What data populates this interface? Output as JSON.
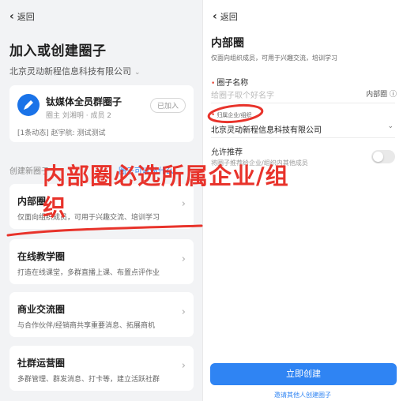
{
  "left": {
    "back": "返回",
    "title": "加入或创建圈子",
    "org": "北京灵动新程信息科技有限公司",
    "joined_circle": {
      "name": "钛媒体全员群圈子",
      "meta": "圈主 刘湘明 · 成员 2",
      "status": "已加入",
      "activity": "[1条动态] 赵宇航: 测试测试"
    },
    "section_label": "创建新圈子",
    "section_hint": "圈子可以做什么",
    "types": [
      {
        "name": "内部圈",
        "desc": "仅面向组织成员，可用于兴趣交流、培训学习"
      },
      {
        "name": "在线教学圈",
        "desc": "打造在线课堂，多群直播上课、布置点评作业"
      },
      {
        "name": "商业交流圈",
        "desc": "与合作伙伴/经销商共享重要消息、拓展商机"
      },
      {
        "name": "社群运营圈",
        "desc": "多群管理、群发消息、打卡等，建立活跃社群"
      }
    ]
  },
  "right": {
    "back": "返回",
    "title": "内部圈",
    "subtitle": "仅面向组织成员，可用于兴趣交流，培训学习",
    "name_label": "圈子名称",
    "name_placeholder": "给圈子取个好名字",
    "name_tag": "内部圈",
    "org_label": "归属企业/组织",
    "org_value": "北京灵动新程信息科技有限公司",
    "recommend_label": "允许推荐",
    "recommend_desc": "将圈子推荐给企业/组织内其他成员",
    "create_button": "立即创建",
    "invite_link": "邀请其他人创建圈子"
  },
  "annotation": {
    "text_line1": "内部圈必选所属企业/组",
    "text_line2": "织",
    "color": "#e8332b"
  }
}
